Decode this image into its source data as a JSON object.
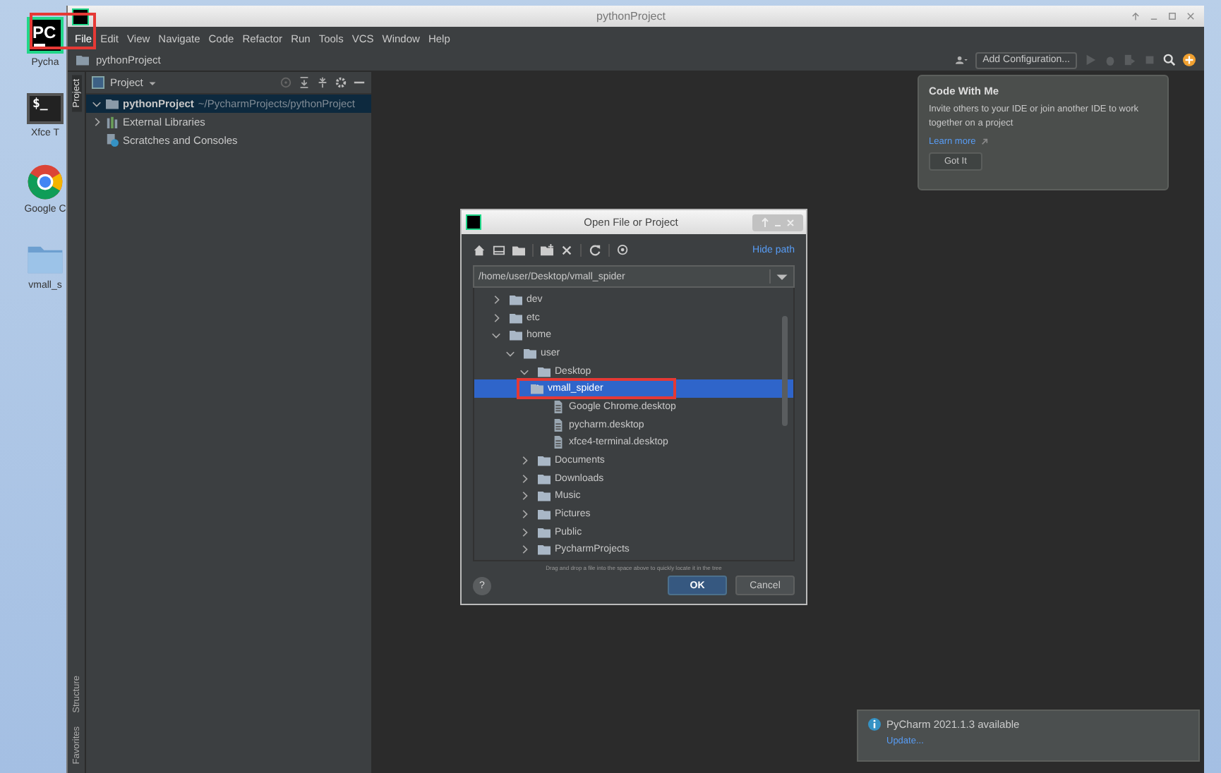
{
  "desktop_icons": [
    {
      "label": "Pycha",
      "kind": "pycharm",
      "glyph": "PC"
    },
    {
      "label": "Xfce T",
      "kind": "terminal",
      "glyph": "$_"
    },
    {
      "label": "Google C",
      "kind": "chrome"
    },
    {
      "label": "vmall_s",
      "kind": "folder"
    }
  ],
  "window": {
    "title": "pythonProject"
  },
  "menu": [
    {
      "label": "File",
      "highlighted": true
    },
    {
      "label": "Edit",
      "highlighted": false
    },
    {
      "label": "View",
      "highlighted": false
    },
    {
      "label": "Navigate",
      "highlighted": false
    },
    {
      "label": "Code",
      "highlighted": false
    },
    {
      "label": "Refactor",
      "highlighted": false
    },
    {
      "label": "Run",
      "highlighted": false
    },
    {
      "label": "Tools",
      "highlighted": false
    },
    {
      "label": "VCS",
      "highlighted": false
    },
    {
      "label": "Window",
      "highlighted": false
    },
    {
      "label": "Help",
      "highlighted": false
    }
  ],
  "navbar": {
    "breadcrumb": "pythonProject",
    "run_config": "Add Configuration..."
  },
  "side_tabs": {
    "top": [
      {
        "label": "Project",
        "selected": true
      }
    ],
    "bottom": [
      {
        "label": "Structure",
        "selected": false
      },
      {
        "label": "Favorites",
        "selected": false
      }
    ]
  },
  "project_panel": {
    "title": "Project",
    "tree": [
      {
        "label": "pythonProject",
        "path": "~/PycharmProjects/pythonProject",
        "kind": "project",
        "expanded": true,
        "selected": true
      },
      {
        "label": "External Libraries",
        "kind": "libraries",
        "expanded": false,
        "selected": false
      },
      {
        "label": "Scratches and Consoles",
        "kind": "scratches",
        "selected": false
      }
    ]
  },
  "tooltip": {
    "title": "Code With Me",
    "text": "Invite others to your IDE or join another IDE to work together on a project",
    "link": "Learn more",
    "button": "Got It"
  },
  "dialog": {
    "title": "Open File or Project",
    "hide_path": "Hide path",
    "path": "/home/user/Desktop/vmall_spider",
    "tree": [
      {
        "label": "dev",
        "kind": "folder",
        "expanded": false,
        "selected": false,
        "highlighted": false
      },
      {
        "label": "etc",
        "kind": "folder",
        "expanded": false,
        "selected": false,
        "highlighted": false
      },
      {
        "label": "home",
        "kind": "folder",
        "expanded": true,
        "selected": false,
        "highlighted": false,
        "children": [
          {
            "label": "user",
            "kind": "folder",
            "expanded": true,
            "selected": false,
            "highlighted": false,
            "children": [
              {
                "label": "Desktop",
                "kind": "folder",
                "expanded": true,
                "selected": false,
                "highlighted": false,
                "children": [
                  {
                    "label": "vmall_spider",
                    "kind": "folder",
                    "expanded": false,
                    "selected": true,
                    "highlighted": true
                  },
                  {
                    "label": "Google Chrome.desktop",
                    "kind": "file",
                    "selected": false,
                    "highlighted": false
                  },
                  {
                    "label": "pycharm.desktop",
                    "kind": "file",
                    "selected": false,
                    "highlighted": false
                  },
                  {
                    "label": "xfce4-terminal.desktop",
                    "kind": "file",
                    "selected": false,
                    "highlighted": false
                  }
                ]
              },
              {
                "label": "Documents",
                "kind": "folder",
                "expanded": false,
                "selected": false,
                "highlighted": false
              },
              {
                "label": "Downloads",
                "kind": "folder",
                "expanded": false,
                "selected": false,
                "highlighted": false
              },
              {
                "label": "Music",
                "kind": "folder",
                "expanded": false,
                "selected": false,
                "highlighted": false
              },
              {
                "label": "Pictures",
                "kind": "folder",
                "expanded": false,
                "selected": false,
                "highlighted": false
              },
              {
                "label": "Public",
                "kind": "folder",
                "expanded": false,
                "selected": false,
                "highlighted": false
              },
              {
                "label": "PycharmProjects",
                "kind": "folder",
                "expanded": false,
                "selected": false,
                "highlighted": false
              }
            ]
          }
        ]
      }
    ],
    "hint": "Drag and drop a file into the space above to quickly locate it in the tree",
    "help": "?",
    "buttons": [
      {
        "label": "OK",
        "kind": "primary"
      },
      {
        "label": "Cancel",
        "kind": "secondary"
      }
    ]
  },
  "notification": {
    "title": "PyCharm 2021.1.3 available",
    "link": "Update..."
  }
}
